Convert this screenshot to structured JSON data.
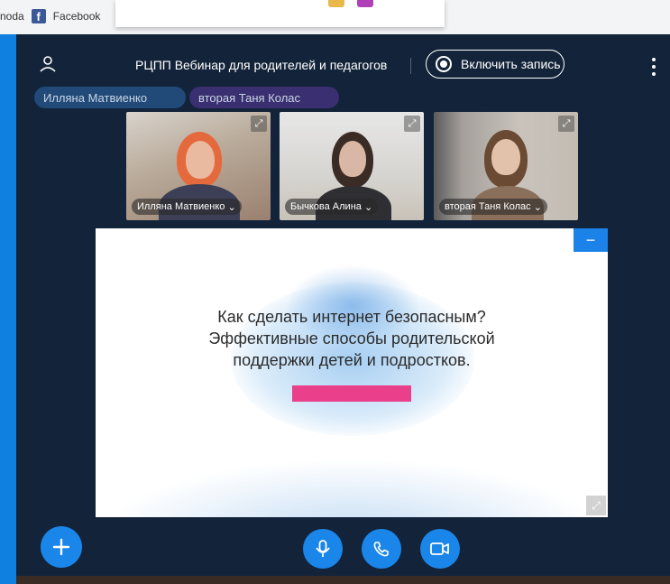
{
  "browser": {
    "bookmark_partial": "noda",
    "bookmark_facebook": "Facebook"
  },
  "meeting": {
    "title": "РЦПП Вебинар для родителей и педагогов",
    "record_label": "Включить запись"
  },
  "chips": [
    {
      "label": "Илляна Матвиенко"
    },
    {
      "label": "вторая Таня Колас"
    }
  ],
  "participants": [
    {
      "name": "Илляна Матвиенко"
    },
    {
      "name": "Бычкова Алина"
    },
    {
      "name": "вторая Таня Колас"
    }
  ],
  "slide": {
    "line1": "Как сделать интернет безопасным?",
    "line2": "Эффективные способы родительской",
    "line3": "поддержки детей и подростков."
  },
  "controls": {
    "add": "+",
    "minimize": "−"
  },
  "icons": [
    "user-icon",
    "record-icon",
    "more-icon",
    "expand-icon",
    "add-icon",
    "microphone-icon",
    "phone-icon",
    "video-icon",
    "facebook-icon"
  ],
  "colors": {
    "app_background": "#13243a",
    "accent_blue": "#1a86ea",
    "pink": "#ea3f8b",
    "outer_blue": "#0f7fe0"
  }
}
